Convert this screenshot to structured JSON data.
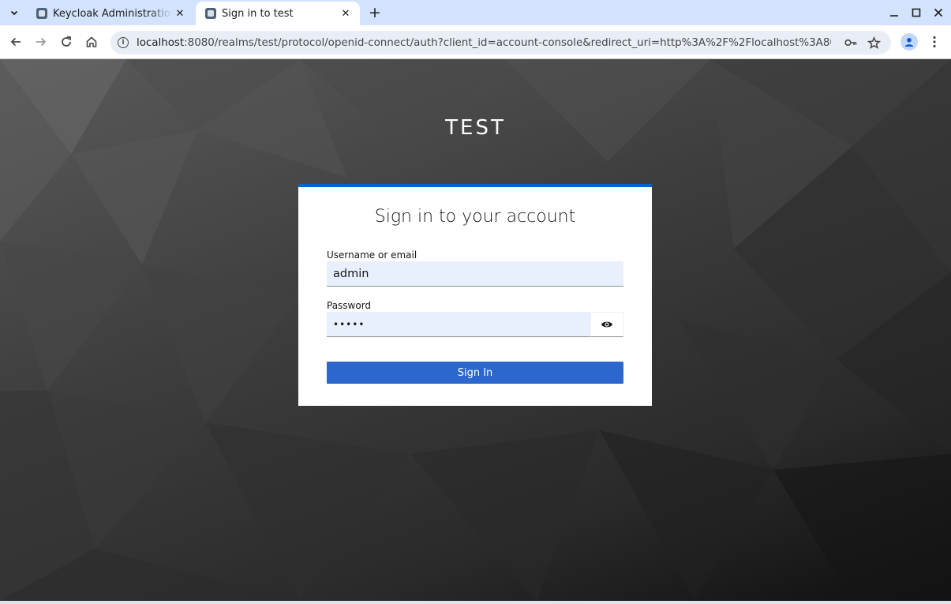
{
  "browser": {
    "tabs": [
      {
        "title": "Keycloak Administration Console",
        "active": false
      },
      {
        "title": "Sign in to test",
        "active": true
      }
    ],
    "omnibox": {
      "url_host": "localhost",
      "url_rest": ":8080/realms/test/protocol/openid-connect/auth?client_id=account-console&redirect_uri=http%3A%2F%2Flocalhost%3A8080%..."
    },
    "icons": {
      "tab_search": "chevron-down-icon",
      "new_tab": "plus-icon",
      "back": "back-arrow-icon",
      "forward": "forward-arrow-icon",
      "reload": "reload-icon",
      "home": "home-icon",
      "site_info": "info-icon",
      "password_key": "key-icon",
      "bookmark": "star-icon",
      "profile": "profile-icon",
      "menu": "more-vertical-icon"
    }
  },
  "page": {
    "realm_title": "TEST",
    "form": {
      "heading": "Sign in to your account",
      "username_label": "Username or email",
      "username_value": "admin",
      "password_label": "Password",
      "password_value": "•••••",
      "submit_label": "Sign In"
    }
  },
  "colors": {
    "accent": "#0066cc",
    "button": "#2b67cc",
    "input_bg": "#e8f0fe",
    "tabstrip": "#d3e3fd"
  }
}
